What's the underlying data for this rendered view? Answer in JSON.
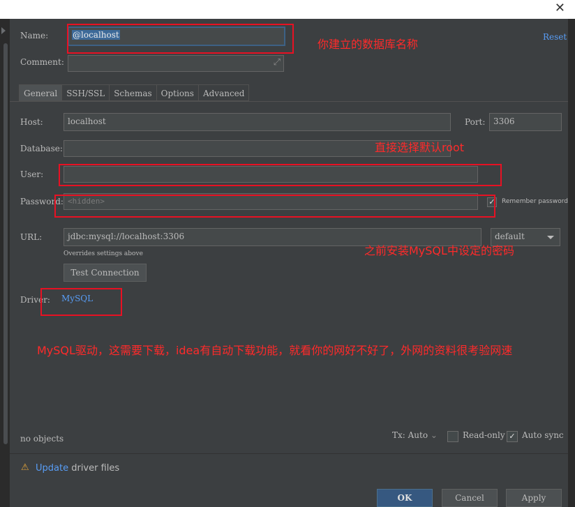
{
  "form": {
    "name_label": "Name:",
    "name_value": "@localhost",
    "reset": "Reset",
    "comment_label": "Comment:",
    "expand_icon": "⤢"
  },
  "tabs": [
    {
      "label": "General"
    },
    {
      "label": "SSH/SSL"
    },
    {
      "label": "Schemas"
    },
    {
      "label": "Options"
    },
    {
      "label": "Advanced"
    }
  ],
  "general": {
    "host_label": "Host:",
    "host_value": "localhost",
    "port_label": "Port:",
    "port_value": "3306",
    "database_label": "Database:",
    "user_label": "User:",
    "password_label": "Password:",
    "password_placeholder": "<hidden>",
    "remember_password": "Remember password",
    "url_label": "URL:",
    "url_value": "jdbc:mysql://localhost:3306",
    "url_mode": "default",
    "url_hint": "Overrides settings above",
    "test_connection": "Test Connection",
    "driver_label": "Driver:",
    "driver_value": "MySQL"
  },
  "annotations": {
    "name_note": "你建立的数据库名称",
    "user_note": "直接选择默认root",
    "password_note": "之前安装MySQL中设定的密码",
    "driver_note": "MySQL驱动，这需要下载，idea有自动下载功能，就看你的网好不好了，外网的资料很考验网速"
  },
  "bottom": {
    "status": "no objects",
    "tx_label": "Tx: Auto",
    "tx_arrow": "⌄",
    "read_only": "Read-only",
    "auto_sync": "Auto sync",
    "warn_icon": "⚠",
    "update_link": "Update",
    "update_text": " driver files"
  },
  "buttons": {
    "ok": "OK",
    "cancel": "Cancel",
    "apply": "Apply"
  },
  "colors": {
    "background": "#3c3f41",
    "field": "#45494a",
    "link": "#589df6",
    "annotation": "#ff2a2a",
    "primary_button": "#365880"
  }
}
